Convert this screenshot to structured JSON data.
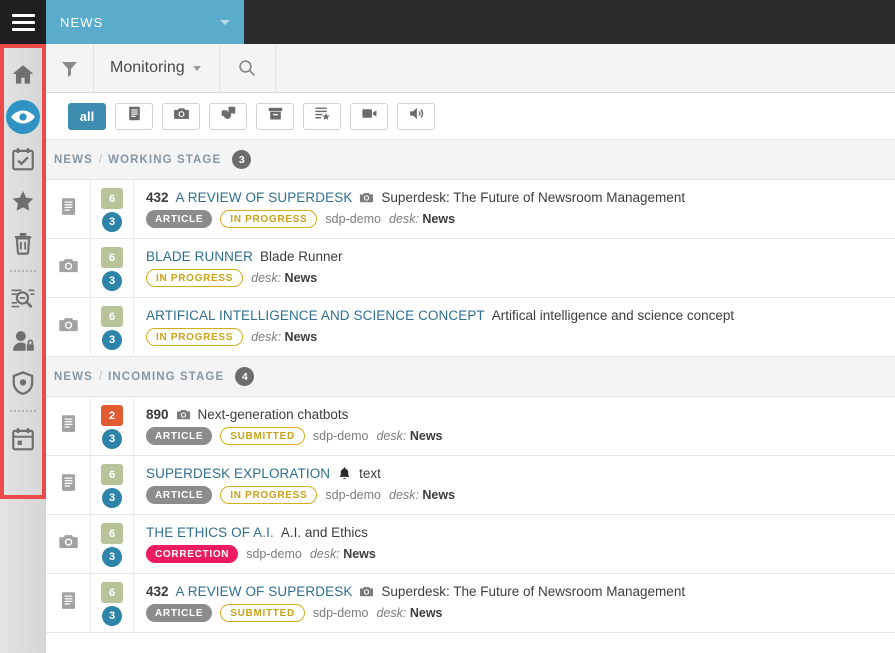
{
  "topbar": {
    "menu_icon": "hamburger-icon",
    "desk_tab_label": "NEWS",
    "desk_tab_color": "#5bacca",
    "background": "#2b2b2b"
  },
  "sidebar": {
    "highlight_color": "#ef4a4a",
    "active_color": "#2f93c3",
    "items": [
      {
        "icon": "home-icon",
        "name": "home",
        "active": false
      },
      {
        "icon": "eye-icon",
        "name": "monitoring",
        "active": true
      },
      {
        "icon": "calendar-check-icon",
        "name": "tasks",
        "active": false
      },
      {
        "icon": "star-icon",
        "name": "highlights",
        "active": false
      },
      {
        "icon": "trash-icon",
        "name": "spike",
        "active": false
      },
      {
        "icon": "divider",
        "name": "divider-1",
        "active": false
      },
      {
        "icon": "search-document-icon",
        "name": "search",
        "active": false
      },
      {
        "icon": "person-lock-icon",
        "name": "privileges",
        "active": false
      },
      {
        "icon": "shield-icon",
        "name": "security",
        "active": false
      },
      {
        "icon": "divider",
        "name": "divider-2",
        "active": false
      },
      {
        "icon": "calendar-icon",
        "name": "planning",
        "active": false
      }
    ]
  },
  "toolbar": {
    "filter_icon": "filter-funnel-icon",
    "title": "Monitoring",
    "title_caret": "chevron-down-icon",
    "search_icon": "search-icon"
  },
  "filter_chips": [
    {
      "label": "all",
      "icon": "",
      "active": true,
      "name": "filter-all"
    },
    {
      "label": "",
      "icon": "text-document-icon",
      "active": false,
      "name": "filter-text"
    },
    {
      "label": "",
      "icon": "camera-icon",
      "active": false,
      "name": "filter-picture"
    },
    {
      "label": "",
      "icon": "graphic-icon",
      "active": false,
      "name": "filter-graphic"
    },
    {
      "label": "",
      "icon": "archive-icon",
      "active": false,
      "name": "filter-archive"
    },
    {
      "label": "",
      "icon": "composite-icon",
      "active": false,
      "name": "filter-composite"
    },
    {
      "label": "",
      "icon": "video-icon",
      "active": false,
      "name": "filter-video"
    },
    {
      "label": "",
      "icon": "audio-icon",
      "active": false,
      "name": "filter-audio"
    }
  ],
  "stages": [
    {
      "desk": "NEWS",
      "separator": "/",
      "name": "WORKING STAGE",
      "count": "3",
      "items": [
        {
          "type_icon": "text-document-icon",
          "badge_square": "6",
          "badge_square_urgent": false,
          "badge_circle": "3",
          "number": "432",
          "slugline": "A REVIEW OF SUPERDESK",
          "inline_icon": "camera-icon",
          "headline": "Superdesk: The Future of Newsroom Management",
          "type_pill": "ARTICLE",
          "state_pill": "IN PROGRESS",
          "state_style": "state",
          "provider": "sdp-demo",
          "desk_label": "desk:",
          "desk_value": "News"
        },
        {
          "type_icon": "camera-icon",
          "badge_square": "6",
          "badge_square_urgent": false,
          "badge_circle": "3",
          "number": "",
          "slugline": "BLADE RUNNER",
          "inline_icon": "",
          "headline": "Blade Runner",
          "type_pill": "",
          "state_pill": "IN PROGRESS",
          "state_style": "state",
          "provider": "",
          "desk_label": "desk:",
          "desk_value": "News"
        },
        {
          "type_icon": "camera-icon",
          "badge_square": "6",
          "badge_square_urgent": false,
          "badge_circle": "3",
          "number": "",
          "slugline": "ARTIFICAL INTELLIGENCE AND SCIENCE CONCEPT",
          "inline_icon": "",
          "headline": "Artifical intelligence and science concept",
          "type_pill": "",
          "state_pill": "IN PROGRESS",
          "state_style": "state",
          "provider": "",
          "desk_label": "desk:",
          "desk_value": "News"
        }
      ]
    },
    {
      "desk": "NEWS",
      "separator": "/",
      "name": "INCOMING STAGE",
      "count": "4",
      "items": [
        {
          "type_icon": "text-document-icon",
          "badge_square": "2",
          "badge_square_urgent": true,
          "badge_circle": "3",
          "number": "890",
          "slugline": "",
          "inline_icon": "camera-icon",
          "headline": "Next-generation chatbots",
          "type_pill": "ARTICLE",
          "state_pill": "SUBMITTED",
          "state_style": "state",
          "provider": "sdp-demo",
          "desk_label": "desk:",
          "desk_value": "News"
        },
        {
          "type_icon": "text-document-icon",
          "badge_square": "6",
          "badge_square_urgent": false,
          "badge_circle": "3",
          "number": "",
          "slugline": "SUPERDESK EXPLORATION",
          "inline_icon": "bell-icon",
          "headline": "text",
          "type_pill": "ARTICLE",
          "state_pill": "IN PROGRESS",
          "state_style": "state",
          "provider": "sdp-demo",
          "desk_label": "desk:",
          "desk_value": "News"
        },
        {
          "type_icon": "camera-icon",
          "badge_square": "6",
          "badge_square_urgent": false,
          "badge_circle": "3",
          "number": "",
          "slugline": "THE ETHICS OF A.I.",
          "inline_icon": "",
          "headline": "A.I. and Ethics",
          "type_pill": "",
          "state_pill": "CORRECTION",
          "state_style": "correction",
          "provider": "sdp-demo",
          "desk_label": "desk:",
          "desk_value": "News"
        },
        {
          "type_icon": "text-document-icon",
          "badge_square": "6",
          "badge_square_urgent": false,
          "badge_circle": "3",
          "number": "432",
          "slugline": "A REVIEW OF SUPERDESK",
          "inline_icon": "camera-icon",
          "headline": "Superdesk: The Future of Newsroom Management",
          "type_pill": "ARTICLE",
          "state_pill": "SUBMITTED",
          "state_style": "state",
          "provider": "sdp-demo",
          "desk_label": "desk:",
          "desk_value": "News"
        }
      ]
    }
  ]
}
